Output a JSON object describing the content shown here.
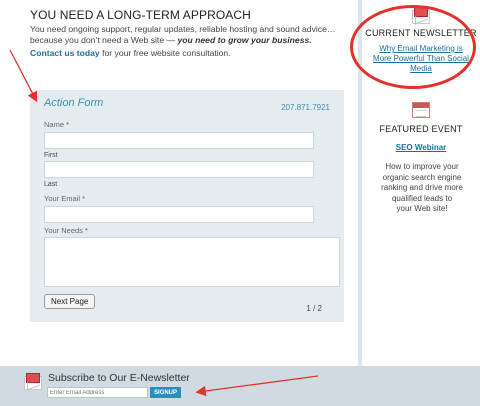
{
  "main": {
    "headline": "YOU NEED A LONG-TERM APPROACH",
    "intro_line1": "You need ongoing support, regular updates, reliable hosting and sound advice…",
    "intro_line2_prefix": "because you don’t need a Web site — ",
    "intro_line2_emphasis": "you need to grow your business.",
    "contact_link": "Contact us today",
    "contact_suffix": " for your free website consultation."
  },
  "form": {
    "title": "Action Form",
    "phone": "207.871.7921",
    "name_label": "Name",
    "first_label": "First",
    "last_label": "Last",
    "email_label": "Your Email",
    "needs_label": "Your Needs",
    "required_marker": "*",
    "next_button": "Next Page",
    "pager": "1 / 2"
  },
  "sidebar": {
    "newsletter_heading": "CURRENT NEWSLETTER",
    "newsletter_link_line1": "Why Email Marketing is",
    "newsletter_link_line2": "More Powerful Than Social",
    "newsletter_link_line3": "Media",
    "event_heading": "FEATURED EVENT",
    "event_link": "SEO Webinar",
    "event_desc_lines": [
      "How to improve your",
      "organic search engine",
      "ranking and drive more",
      "qualified leads to",
      "your Web site!"
    ]
  },
  "footer": {
    "title": "Subscribe to Our E-Newsletter",
    "email_placeholder": "Enter Email Address",
    "signup_button": "SIGNUP"
  },
  "icons": {
    "newsletter_icon": "envelope-icon",
    "event_icon": "calendar-icon",
    "footer_icon": "envelope-icon"
  },
  "colors": {
    "link": "#1f6f9a",
    "accent": "#3b8fb0",
    "required": "#c0332d",
    "annotation": "#e2322a",
    "signup": "#2b8fbd"
  }
}
